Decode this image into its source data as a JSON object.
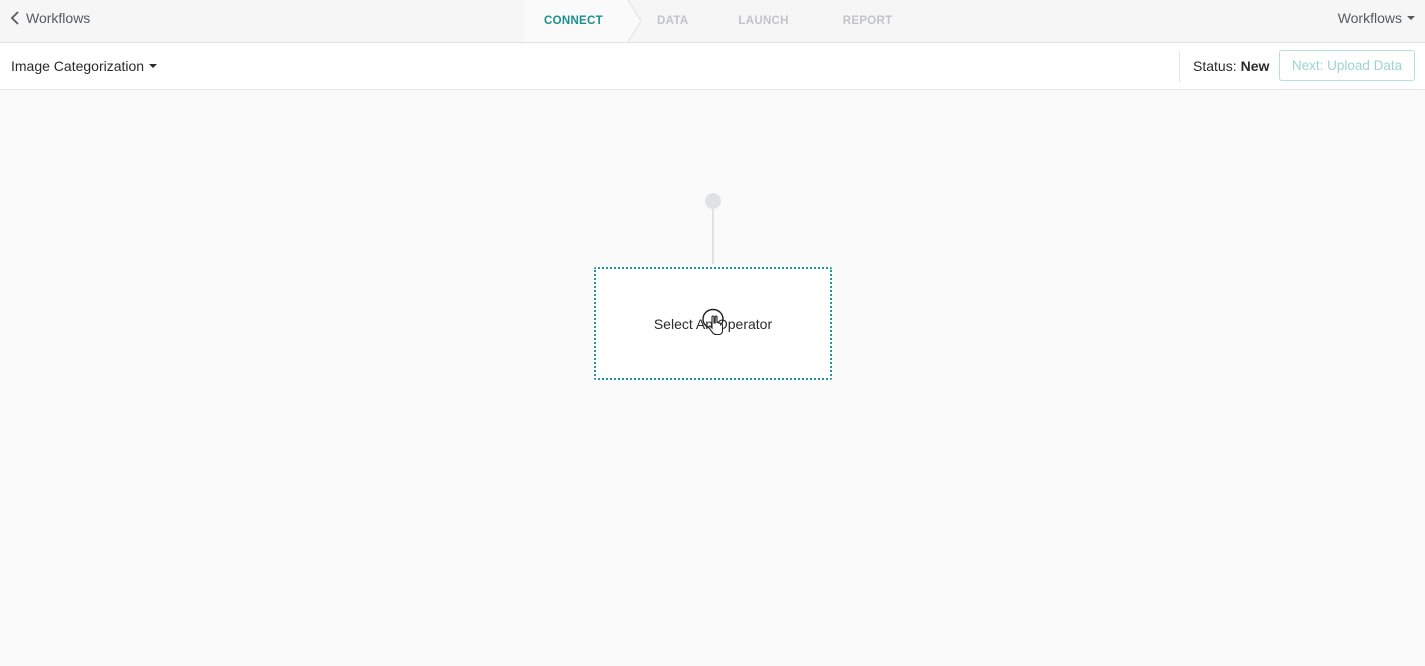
{
  "topnav": {
    "back_label": "Workflows",
    "steps": [
      {
        "label": "CONNECT",
        "active": true
      },
      {
        "label": "DATA",
        "active": false
      },
      {
        "label": "LAUNCH",
        "active": false
      },
      {
        "label": "REPORT",
        "active": false
      }
    ],
    "menu_label": "Workflows"
  },
  "subheader": {
    "workflow_name": "Image Categorization",
    "status_label": "Status:",
    "status_value": "New",
    "next_button_label": "Next: Upload Data"
  },
  "canvas": {
    "operator_placeholder": "Select An Operator"
  },
  "colors": {
    "accent": "#1a8f8f",
    "inactive_step": "#c2c4c8",
    "disabled_button_text": "#9fd2d2"
  },
  "icons": {
    "back": "chevron-left-icon",
    "menu_caret": "caret-down-icon",
    "workflow_caret": "caret-down-icon",
    "cursor": "hand-pointer-icon"
  }
}
